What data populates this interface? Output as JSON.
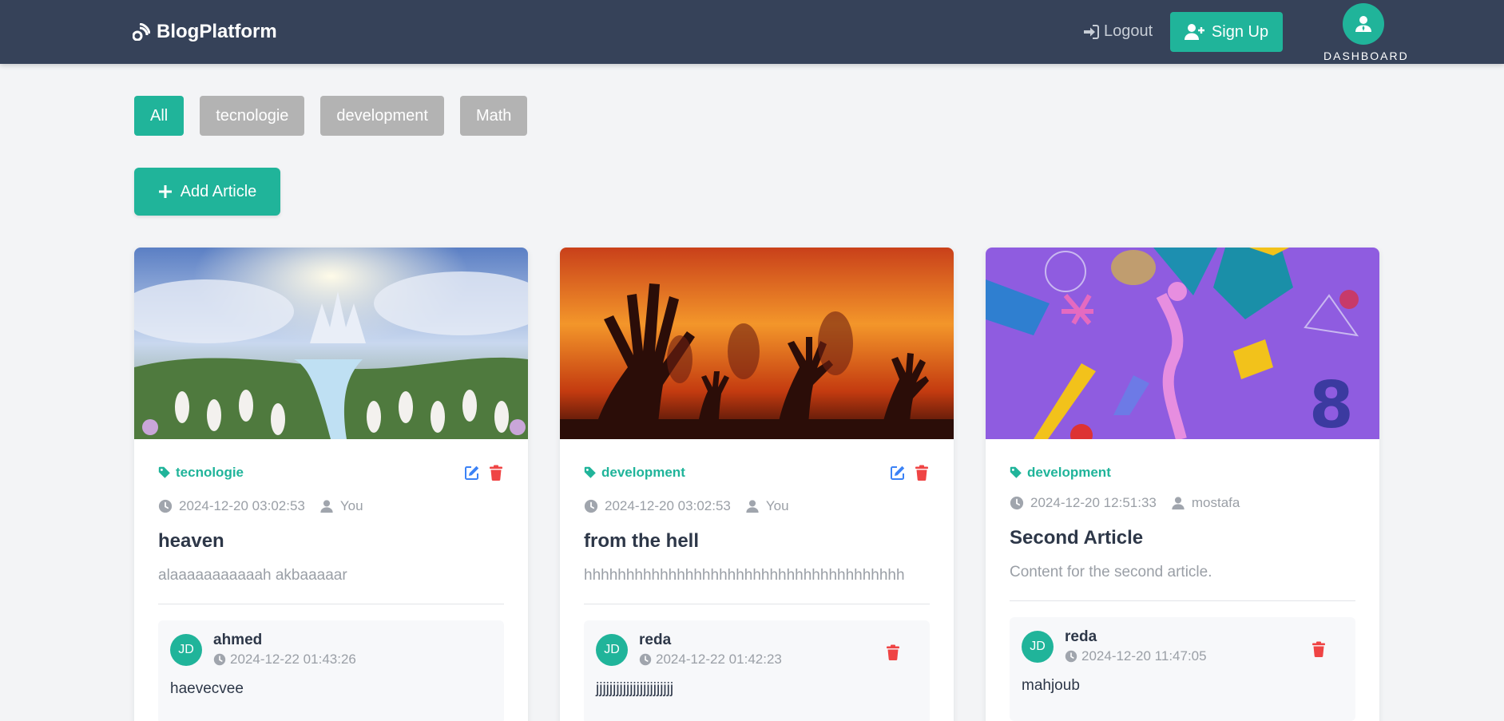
{
  "navbar": {
    "brand": "BlogPlatform",
    "logout": "Logout",
    "signup": "Sign Up",
    "dashboard": "DASHBOARD"
  },
  "filters": [
    "All",
    "tecnologie",
    "development",
    "Math"
  ],
  "add_article": "Add Article",
  "colors": {
    "accent": "#20b49a",
    "nav": "#364259",
    "edit": "#3b82f6",
    "delete": "#ef4444"
  },
  "cards": [
    {
      "tag": "tecnologie",
      "date": "2024-12-20 03:02:53",
      "author": "You",
      "title": "heaven",
      "content": "alaaaaaaaaaaah akbaaaaar",
      "comment": {
        "initials": "JD",
        "author": "ahmed",
        "time": "2024-12-22 01:43:26",
        "text": "haevecvee"
      }
    },
    {
      "tag": "development",
      "date": "2024-12-20 03:02:53",
      "author": "You",
      "title": "from the hell",
      "content": "hhhhhhhhhhhhhhhhhhhhhhhhhhhhhhhhhhhhhh",
      "comment": {
        "initials": "JD",
        "author": "reda",
        "time": "2024-12-22 01:42:23",
        "text": "jjjjjjjjjjjjjjjjjjjjjjj"
      }
    },
    {
      "tag": "development",
      "date": "2024-12-20 12:51:33",
      "author": "mostafa",
      "title": "Second Article",
      "content": "Content for the second article.",
      "comment": {
        "initials": "JD",
        "author": "reda",
        "time": "2024-12-20 11:47:05",
        "text": "mahjoub"
      }
    }
  ]
}
